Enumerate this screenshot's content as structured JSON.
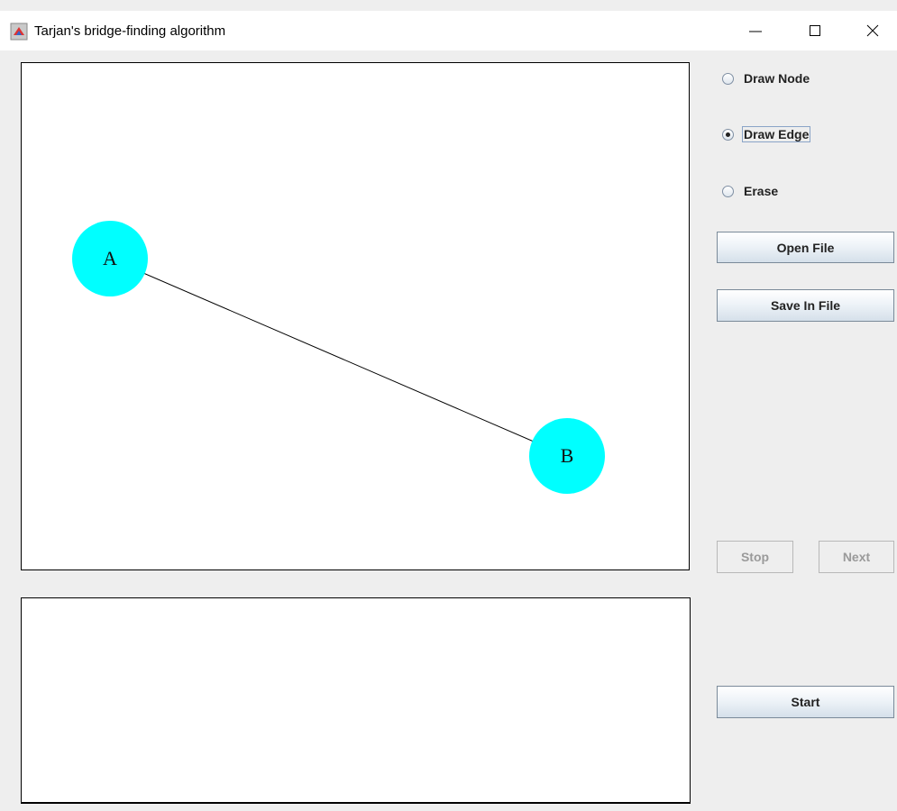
{
  "window": {
    "title": "Tarjan's bridge-finding algorithm"
  },
  "graph": {
    "nodes": [
      {
        "label": "A",
        "color": "#00ffff"
      },
      {
        "label": "B",
        "color": "#00ffff"
      }
    ],
    "edges": [
      {
        "from": "A",
        "to": "B"
      }
    ]
  },
  "controls": {
    "modes": [
      {
        "label": "Draw Node",
        "selected": false
      },
      {
        "label": "Draw Edge",
        "selected": true
      },
      {
        "label": "Erase",
        "selected": false
      }
    ],
    "open_file": "Open File",
    "save_in_file": "Save In File",
    "stop": "Stop",
    "next": "Next",
    "start": "Start"
  },
  "output": {
    "text": ""
  }
}
